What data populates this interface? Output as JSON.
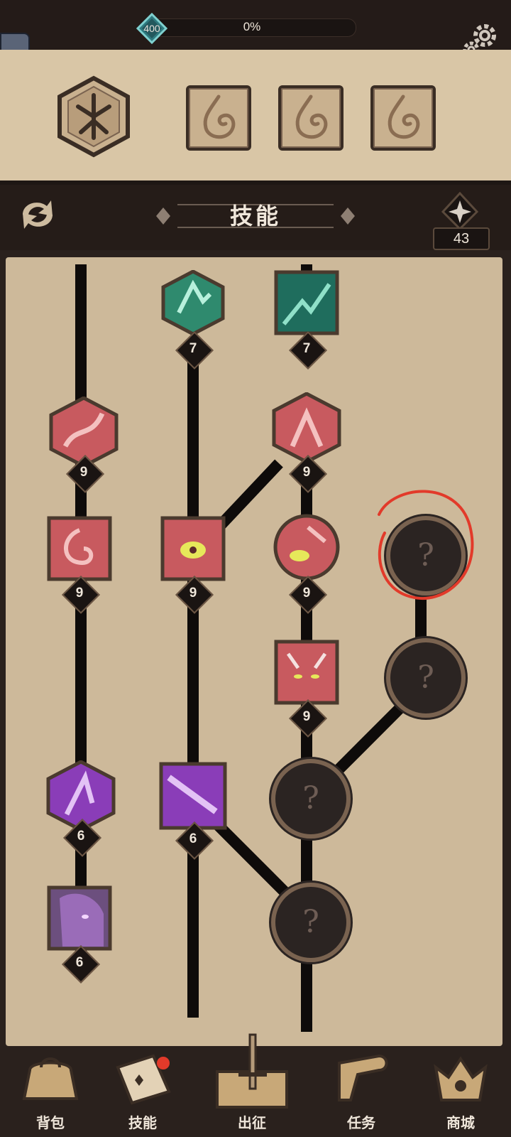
{
  "header": {
    "level": "400",
    "xp_percent": "0%",
    "xp_progress": 0
  },
  "title": "技能",
  "skill_points": "43",
  "skills": {
    "emerald_1": "7",
    "emerald_2": "7",
    "crimson_hex_1": "9",
    "crimson_hex_2": "9",
    "crimson_sq_1": "9",
    "crimson_sq_2": "9",
    "crimson_circle": "9",
    "crimson_face": "9",
    "violet_hex": "6",
    "violet_sq": "6",
    "violet_face": "6"
  },
  "locked_symbol": "?",
  "bottom_nav": {
    "bag": "背包",
    "skills": "技能",
    "expedition": "出征",
    "tasks": "任务",
    "shop": "商城"
  },
  "colors": {
    "parchment": "#cdb99a",
    "dark": "#2a211d",
    "emerald": "#2f8a6e",
    "crimson": "#c85a5f",
    "violet": "#8a3db8",
    "highlight_red": "#e23a2a"
  }
}
